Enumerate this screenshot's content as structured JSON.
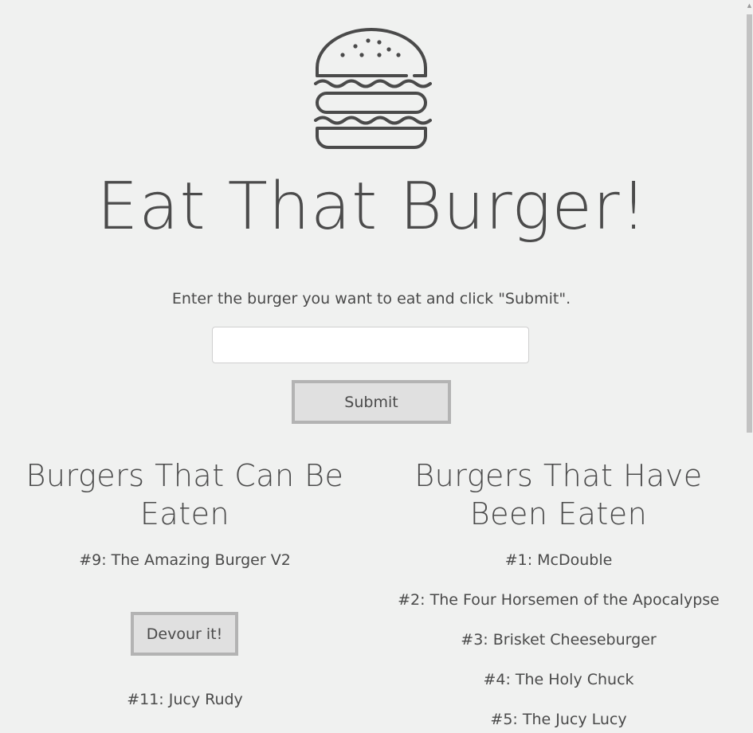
{
  "header": {
    "logo_icon": "burger-icon",
    "title": "Eat That Burger!"
  },
  "form": {
    "instructions": "Enter the burger you want to eat and click \"Submit\".",
    "input_value": "",
    "input_placeholder": "",
    "submit_label": "Submit"
  },
  "available": {
    "heading_line1": "Burgers That Can Be",
    "heading_line2": "Eaten",
    "items": [
      {
        "label": "#9: The Amazing Burger V2",
        "button_label": "Devour it!"
      },
      {
        "label": "#11: Jucy Rudy"
      }
    ]
  },
  "eaten": {
    "heading_line1": "Burgers That Have",
    "heading_line2": "Been Eaten",
    "items": [
      {
        "label": "#1: McDouble"
      },
      {
        "label": "#2: The Four Horsemen of the Apocalypse"
      },
      {
        "label": "#3: Brisket Cheeseburger"
      },
      {
        "label": "#4: The Holy Chuck"
      },
      {
        "label": "#5: The Jucy Lucy"
      }
    ]
  },
  "colors": {
    "background": "#f0f1f0",
    "text": "#4a4a4a",
    "button_bg": "#e0e0e0",
    "button_border": "#b3b3b3"
  }
}
